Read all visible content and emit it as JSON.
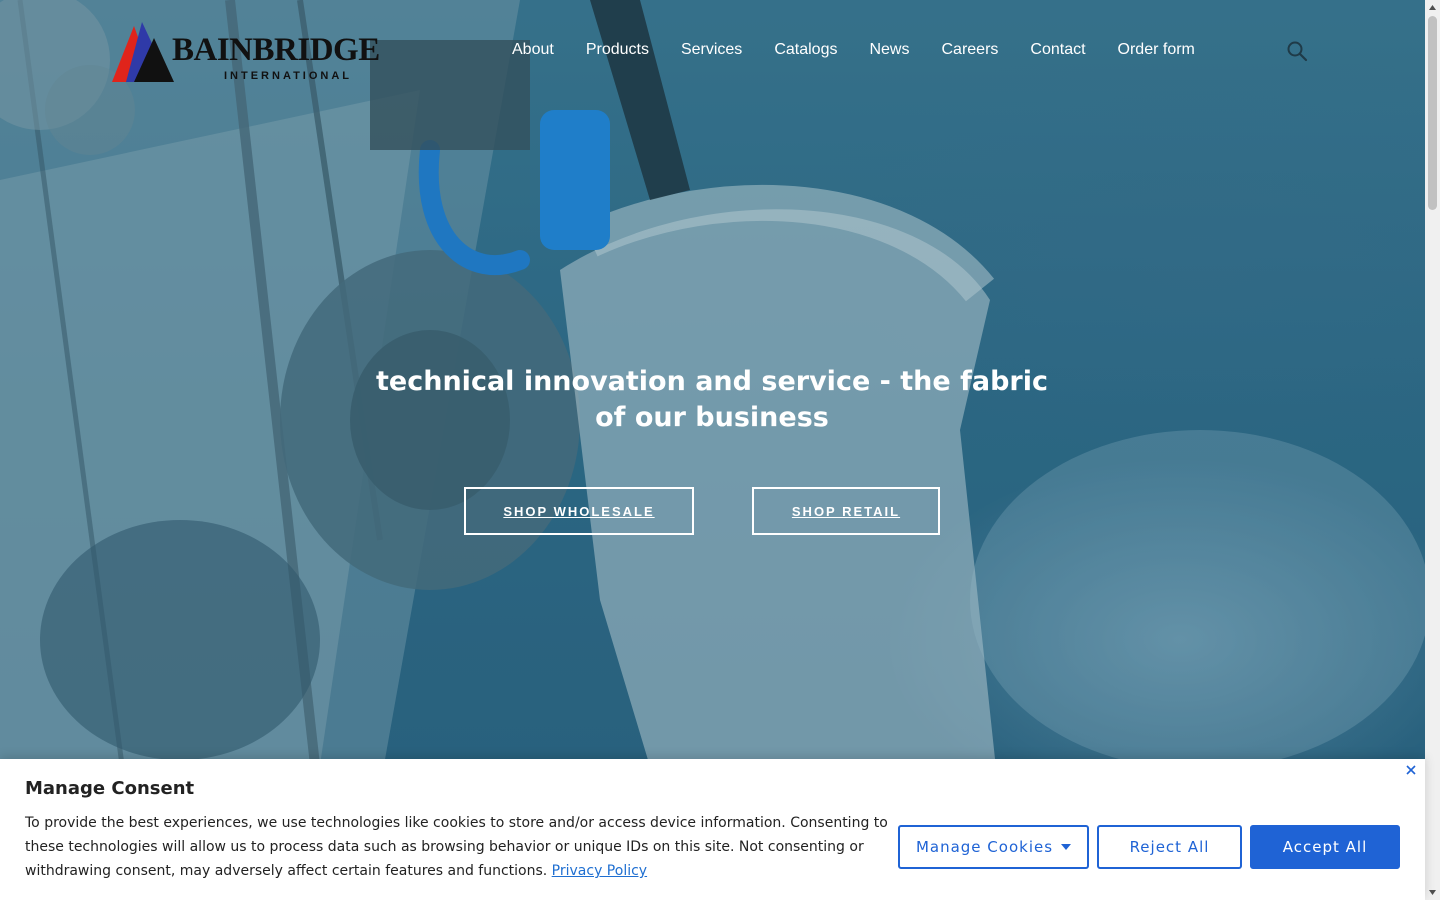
{
  "brand": {
    "name": "BAINBRIDGE",
    "tagline": "INTERNATIONAL"
  },
  "nav": {
    "items": [
      {
        "label": "About"
      },
      {
        "label": "Products"
      },
      {
        "label": "Services"
      },
      {
        "label": "Catalogs"
      },
      {
        "label": "News"
      },
      {
        "label": "Careers"
      },
      {
        "label": "Contact"
      },
      {
        "label": "Order form"
      }
    ],
    "search_icon": "search-icon"
  },
  "hero": {
    "headline": "technical innovation and service - the fabric of our business",
    "cta_wholesale": "SHOP WHOLESALE",
    "cta_retail": "SHOP RETAIL"
  },
  "consent": {
    "title": "Manage Consent",
    "body": "To provide the best experiences, we use technologies like cookies to store and/or access device information. Consenting to these technologies will allow us to process data such as browsing behavior or unique IDs on this site. Not consenting or withdrawing consent, may adversely affect certain features and functions.",
    "privacy_link": "Privacy Policy",
    "manage_label": "Manage Cookies",
    "reject_label": "Reject All",
    "accept_label": "Accept All",
    "close_icon": "close-icon"
  },
  "colors": {
    "accent": "#1f63d5",
    "hero_tint": "#2f6a86",
    "logo_red": "#e0241b",
    "logo_blue": "#2f3aa8"
  }
}
